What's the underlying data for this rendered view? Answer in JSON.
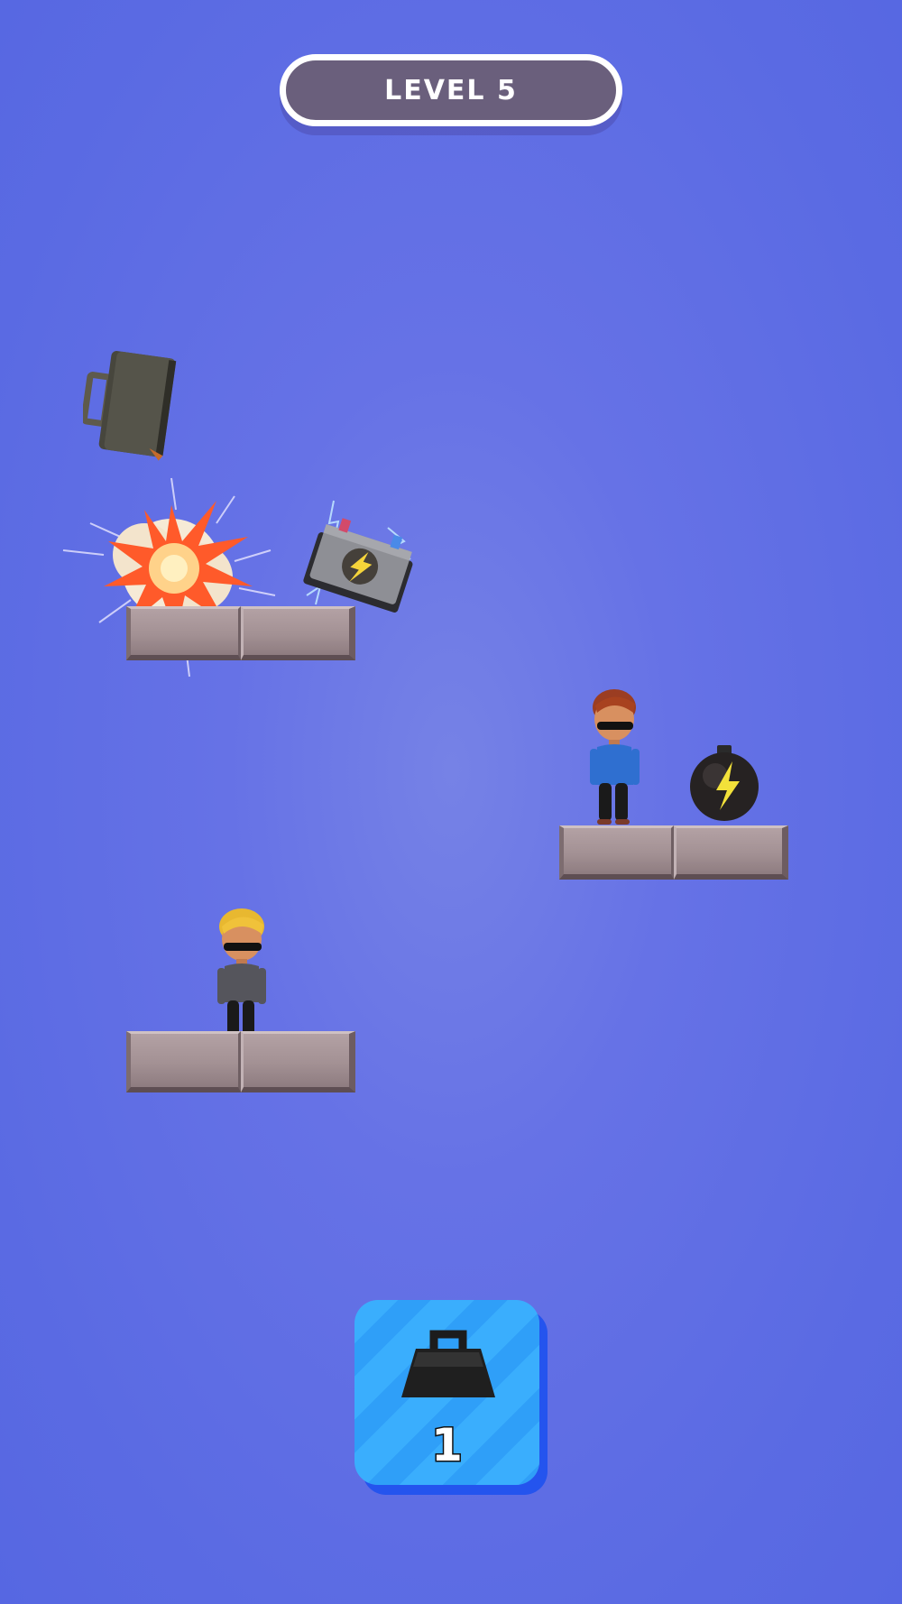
{
  "hud": {
    "level_label": "LEVEL 5"
  },
  "inventory": {
    "item_icon": "weight-icon",
    "count": "1"
  },
  "scene": {
    "objects": [
      {
        "name": "briefcase",
        "icon": "briefcase-icon"
      },
      {
        "name": "explosion",
        "icon": "explosion-icon"
      },
      {
        "name": "battery",
        "icon": "battery-icon"
      },
      {
        "name": "bomb",
        "icon": "bomb-icon"
      },
      {
        "name": "red-haired-agent",
        "icon": "person-icon"
      },
      {
        "name": "blond-agent",
        "icon": "person-icon"
      }
    ]
  },
  "colors": {
    "background": "#5b6be3",
    "level_pill": "#6a5f7c",
    "inventory_card": "#3aaefd",
    "platform": "#a39194"
  }
}
